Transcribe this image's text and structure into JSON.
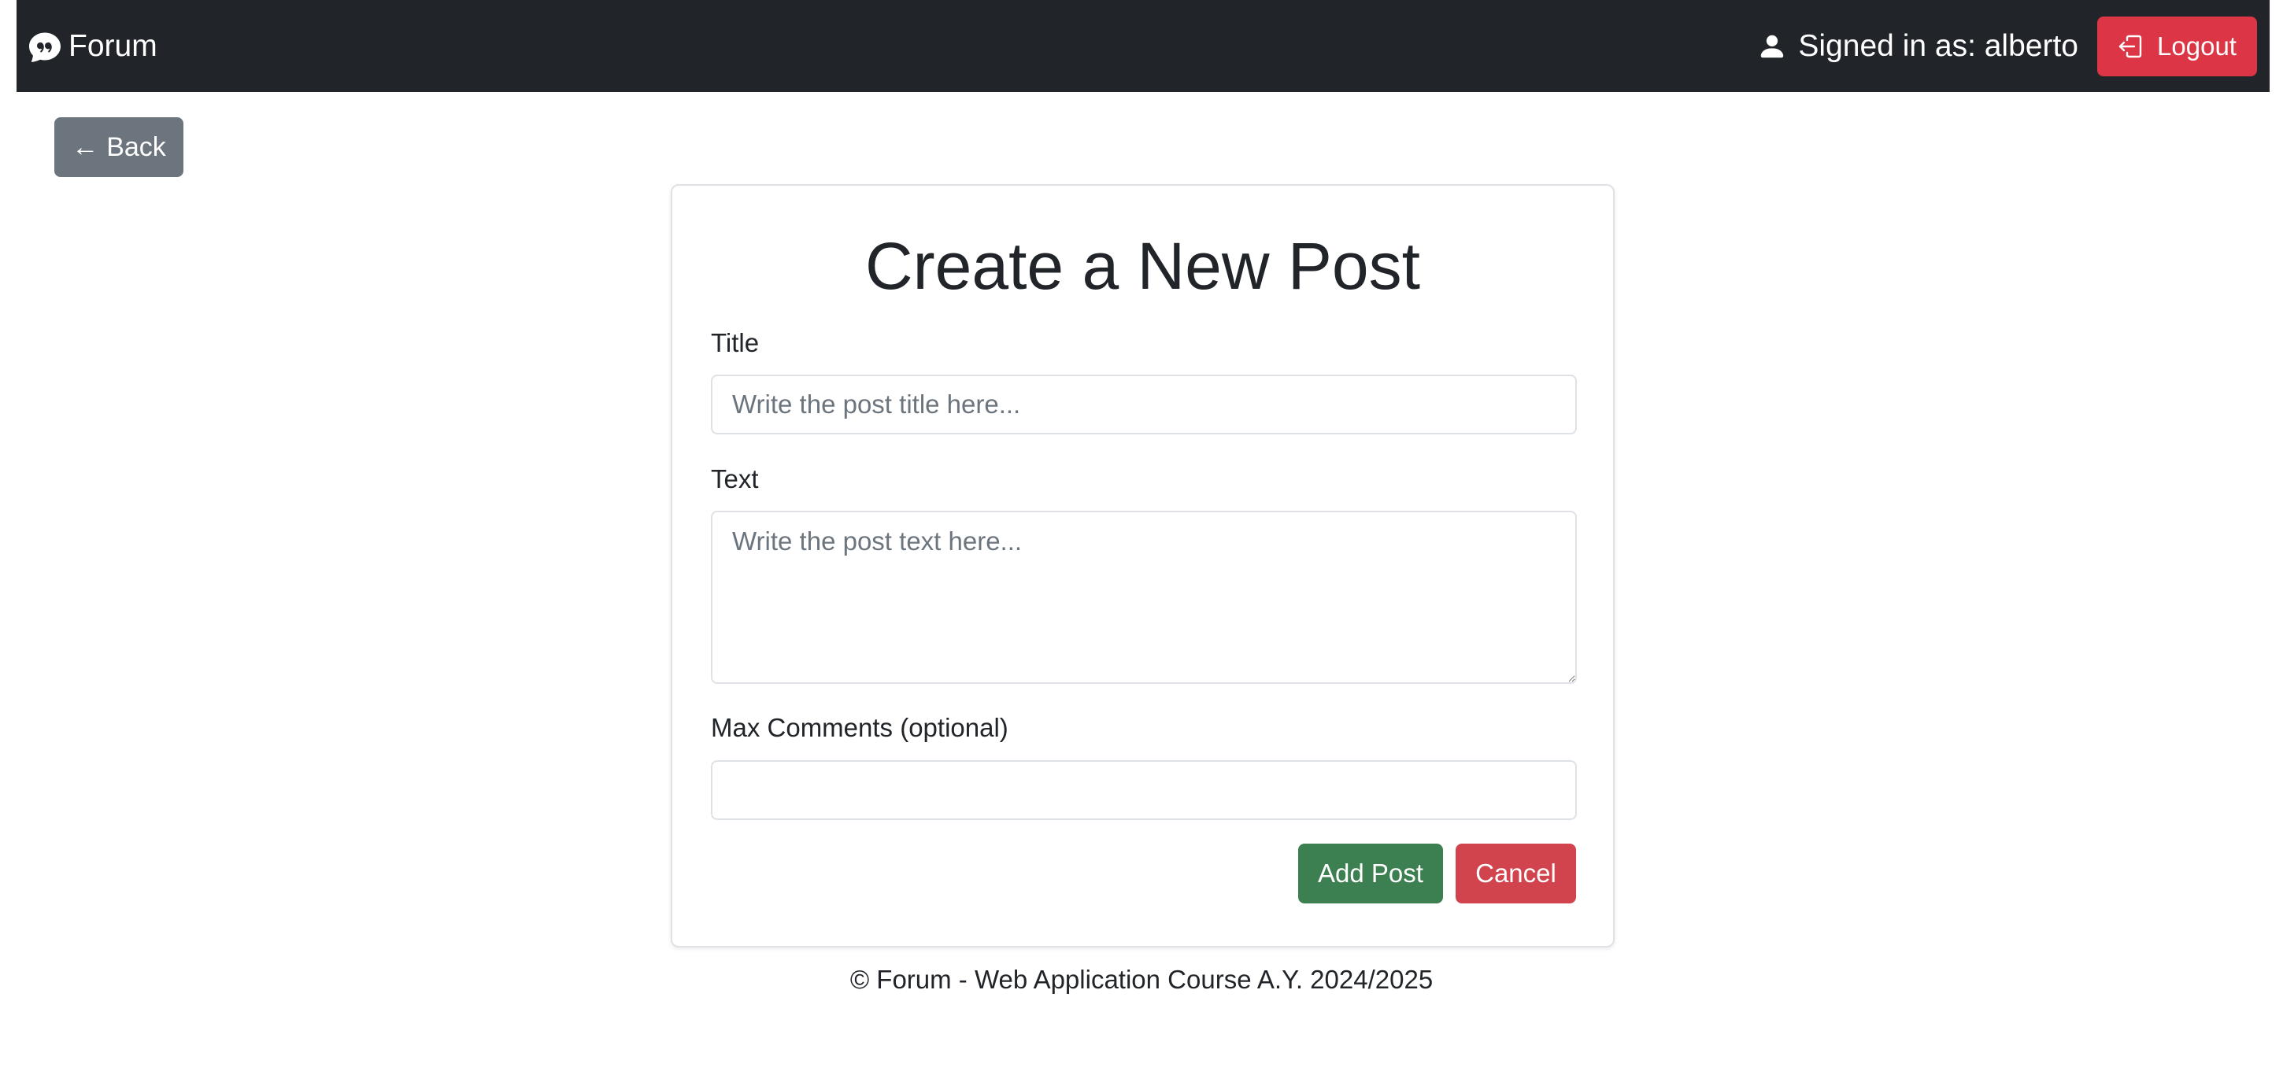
{
  "navbar": {
    "brand_icon": "chat-quote-icon",
    "brand": "Forum",
    "user_icon": "person-icon",
    "signed_in": "Signed in as: alberto",
    "logout_icon": "box-arrow-in-left-icon",
    "logout_label": "Logout",
    "logout_color": "#dc3545",
    "background_color": "#212529"
  },
  "back_button": {
    "arrow": "←",
    "label": "Back",
    "color": "#6c757d"
  },
  "form": {
    "heading": "Create a New Post",
    "title_label": "Title",
    "title_placeholder": "Write the post title here...",
    "title_value": "",
    "text_label": "Text",
    "text_placeholder": "Write the post text here...",
    "text_value": "",
    "max_comments_label": "Max Comments (optional)",
    "max_comments_value": "",
    "add_label": "Add Post",
    "add_color": "#3c7f51",
    "cancel_label": "Cancel",
    "cancel_color": "#d1434d"
  },
  "footer": {
    "text": "© Forum - Web Application Course A.Y. 2024/2025"
  }
}
